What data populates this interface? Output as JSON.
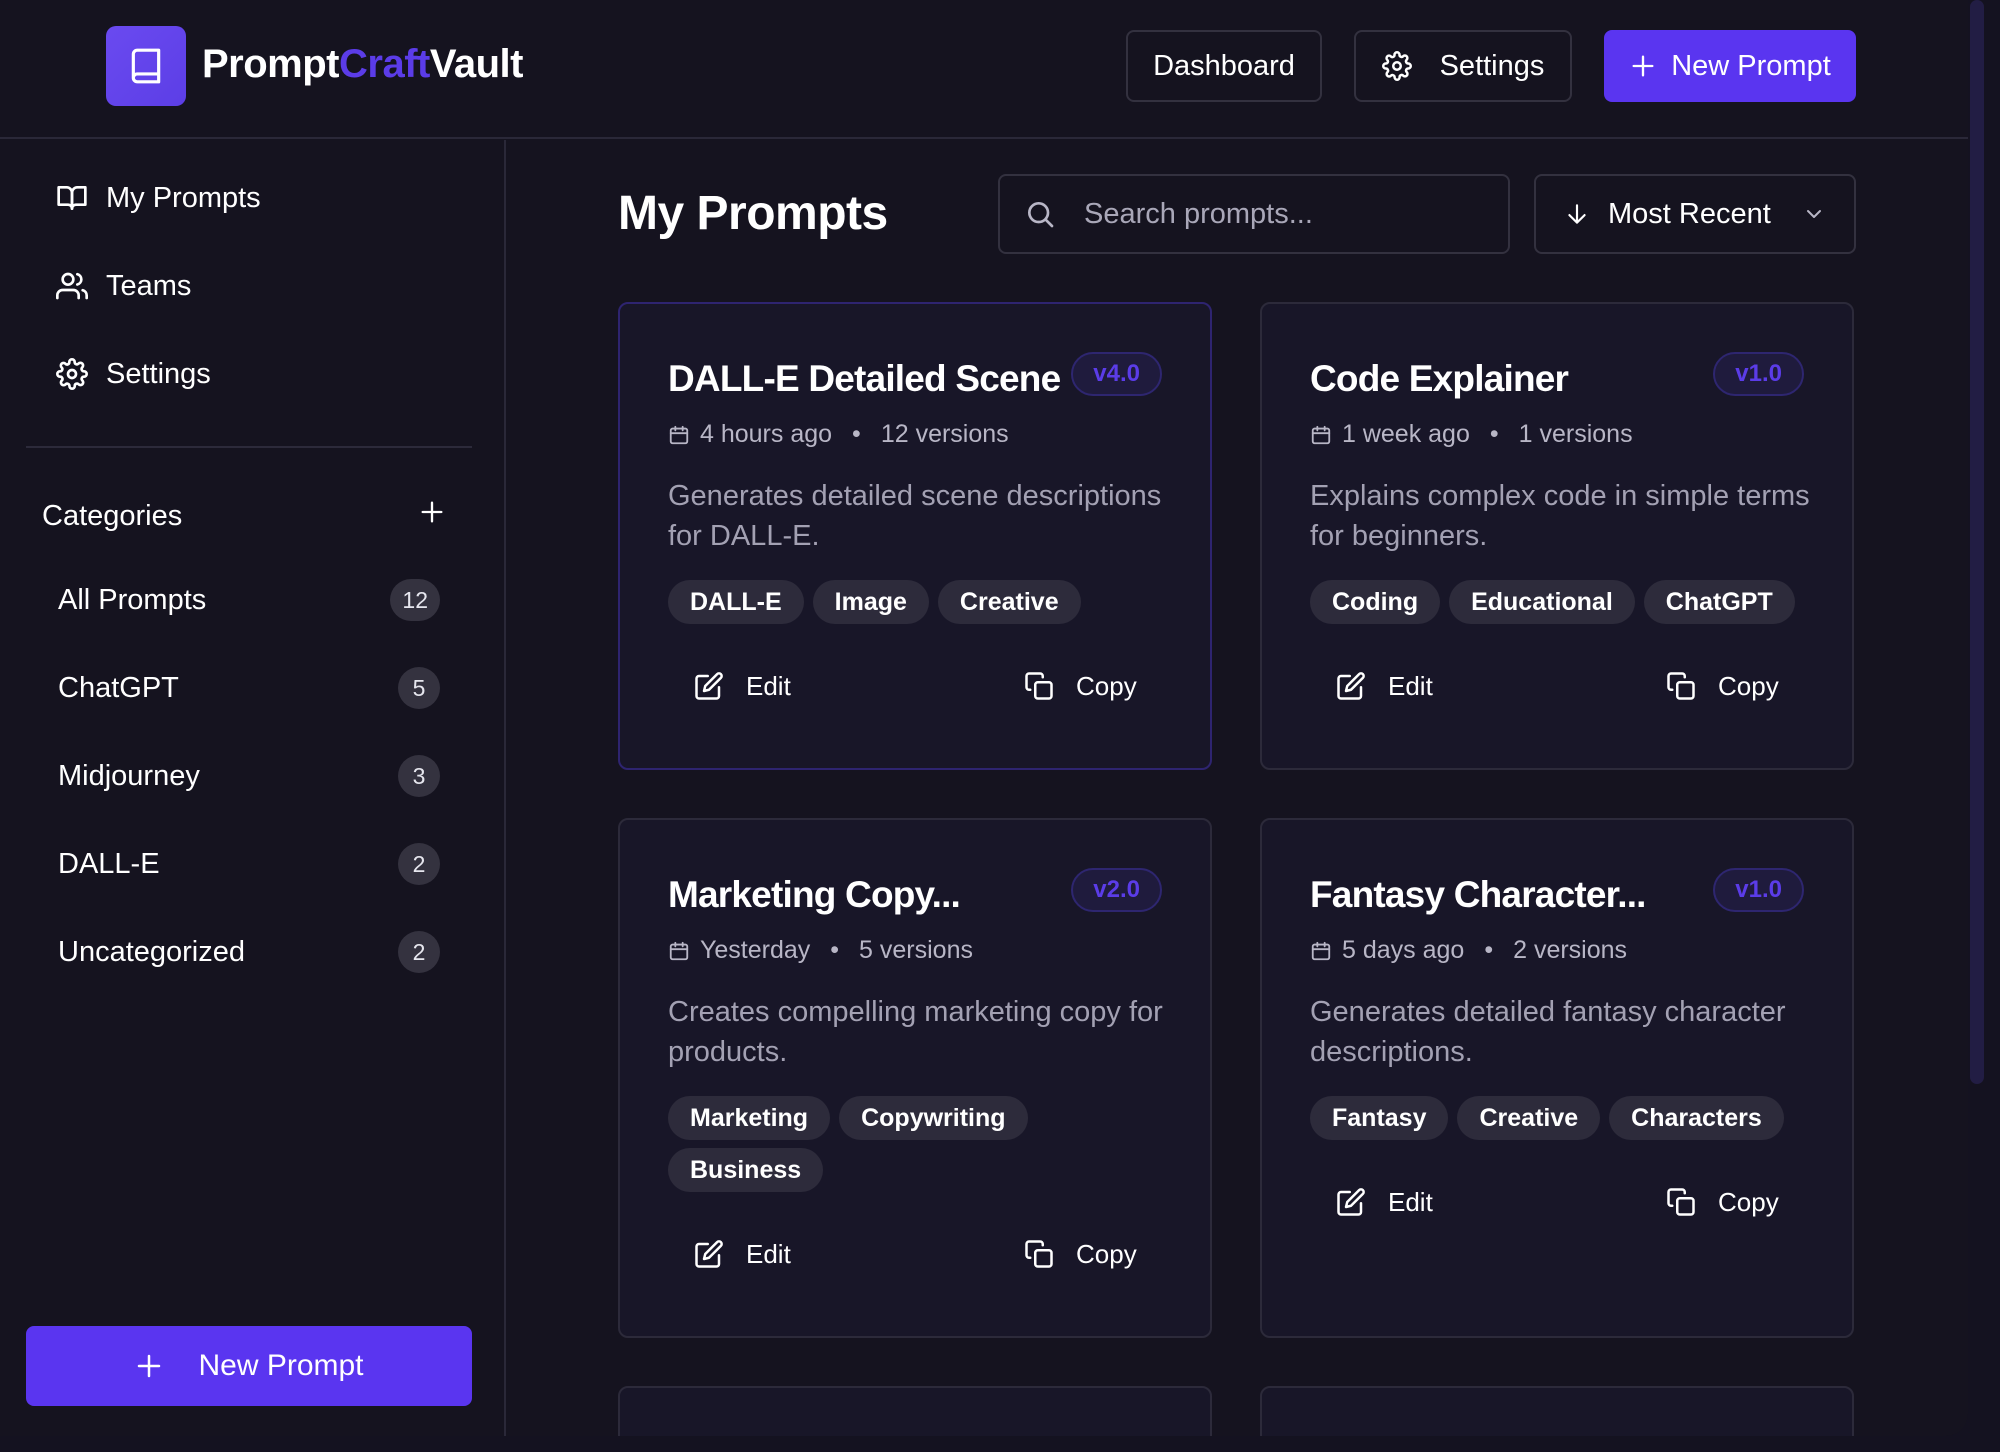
{
  "brand": {
    "part1": "Prompt",
    "part2": "Craft",
    "part3": "Vault"
  },
  "header": {
    "dashboard_label": "Dashboard",
    "settings_label": "Settings",
    "new_prompt_label": "New Prompt"
  },
  "sidebar": {
    "nav": [
      {
        "label": "My Prompts",
        "icon": "book-open-icon"
      },
      {
        "label": "Teams",
        "icon": "users-icon"
      },
      {
        "label": "Settings",
        "icon": "gear-icon"
      }
    ],
    "categories_title": "Categories",
    "categories": [
      {
        "label": "All Prompts",
        "count": "12"
      },
      {
        "label": "ChatGPT",
        "count": "5"
      },
      {
        "label": "Midjourney",
        "count": "3"
      },
      {
        "label": "DALL-E",
        "count": "2"
      },
      {
        "label": "Uncategorized",
        "count": "2"
      }
    ],
    "new_prompt_label": "New Prompt"
  },
  "main": {
    "title": "My Prompts",
    "search_placeholder": "Search prompts...",
    "sort_label": "Most Recent",
    "cards": [
      {
        "title": "DALL-E Detailed Scene",
        "version": "v4.0",
        "time": "4 hours ago",
        "versions": "12 versions",
        "description": "Generates detailed scene descriptions for DALL-E.",
        "tags": [
          "DALL-E",
          "Image",
          "Creative"
        ],
        "edit_label": "Edit",
        "copy_label": "Copy"
      },
      {
        "title": "Code Explainer",
        "version": "v1.0",
        "time": "1 week ago",
        "versions": "1 versions",
        "description": "Explains complex code in simple terms for beginners.",
        "tags": [
          "Coding",
          "Educational",
          "ChatGPT"
        ],
        "edit_label": "Edit",
        "copy_label": "Copy"
      },
      {
        "title": "Marketing Copy...",
        "version": "v2.0",
        "time": "Yesterday",
        "versions": "5 versions",
        "description": "Creates compelling marketing copy for products.",
        "tags": [
          "Marketing",
          "Copywriting",
          "Business"
        ],
        "edit_label": "Edit",
        "copy_label": "Copy"
      },
      {
        "title": "Fantasy Character...",
        "version": "v1.0",
        "time": "5 days ago",
        "versions": "2 versions",
        "description": "Generates detailed fantasy character descriptions.",
        "tags": [
          "Fantasy",
          "Creative",
          "Characters"
        ],
        "edit_label": "Edit",
        "copy_label": "Copy"
      }
    ]
  },
  "colors": {
    "accent": "#5a35f0",
    "background": "#15131f",
    "card": "#181628"
  }
}
